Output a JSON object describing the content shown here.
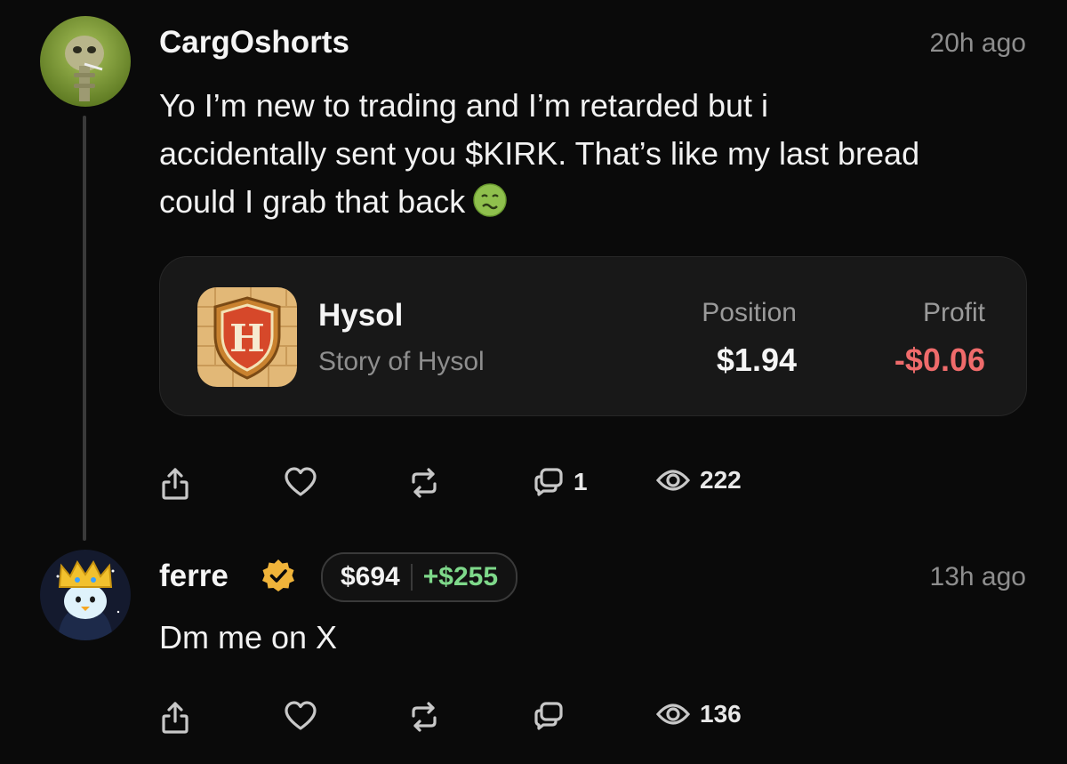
{
  "post": {
    "username": "CargOshorts",
    "timestamp": "20h ago",
    "body_lines": [
      "Yo I’m new to trading and I’m retarded but i",
      "accidentally sent you $KIRK. That’s like my last bread",
      "could I grab that back"
    ],
    "emoji": "nauseated-face-icon",
    "card": {
      "app_name": "Hysol",
      "app_subtitle": "Story of Hysol",
      "position_label": "Position",
      "position_value": "$1.94",
      "profit_label": "Profit",
      "profit_value": "-$0.06",
      "profit_color": "#ef6b6b"
    },
    "actions": {
      "comments_count": "1",
      "views_count": "222"
    }
  },
  "reply": {
    "username": "ferre",
    "verified": true,
    "pnl_total": "$694",
    "pnl_gain": "+$255",
    "gain_color": "#7ed88a",
    "timestamp": "13h ago",
    "body": "Dm me on X",
    "actions": {
      "views_count": "136"
    }
  }
}
